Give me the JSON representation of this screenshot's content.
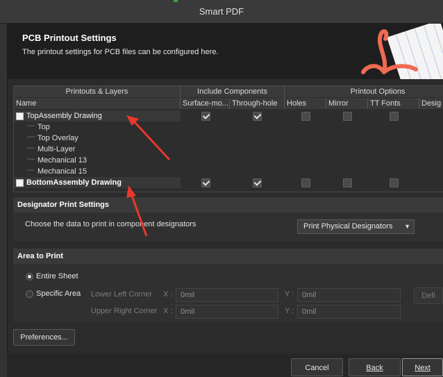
{
  "window": {
    "title": "Smart PDF"
  },
  "header": {
    "title": "PCB Printout Settings",
    "subtitle": "The printout settings for PCB files can be configured here."
  },
  "table": {
    "group_headers": [
      "Printouts & Layers",
      "Include Components",
      "Printout Options"
    ],
    "columns": [
      "Name",
      "Surface-mo...",
      "Through-hole",
      "Holes",
      "Mirror",
      "TT Fonts",
      "Desig"
    ],
    "printouts": [
      {
        "name": "TopAssembly Drawing",
        "surface_mount": true,
        "through_hole": true,
        "holes": false,
        "mirror": false,
        "tt_fonts": false,
        "layers": [
          "Top",
          "Top Overlay",
          "Multi-Layer",
          "Mechanical 13",
          "Mechanical 15"
        ]
      },
      {
        "name": "BottomAssembly Drawing",
        "surface_mount": true,
        "through_hole": true,
        "holes": false,
        "mirror": false,
        "tt_fonts": false,
        "layers": []
      }
    ]
  },
  "designator": {
    "section_title": "Designator Print Settings",
    "prompt": "Choose the data to print in component designators",
    "selected": "Print Physical Designators"
  },
  "area": {
    "section_title": "Area to Print",
    "options": [
      "Entire Sheet",
      "Specific Area"
    ],
    "selected": "Entire Sheet",
    "lower_left_label": "Lower Left Corner",
    "upper_right_label": "Upper Right Corner",
    "x_label": "X :",
    "y_label": "Y :",
    "lower_left_x": "0mil",
    "lower_left_y": "0mil",
    "upper_right_x": "0mil",
    "upper_right_y": "0mil",
    "define_label": "Defi"
  },
  "buttons": {
    "preferences": "Preferences...",
    "cancel": "Cancel",
    "back": "Back",
    "next": "Next"
  },
  "colors": {
    "annotation_arrow": "#e8392b",
    "logo_accent": "#ef6a52"
  }
}
